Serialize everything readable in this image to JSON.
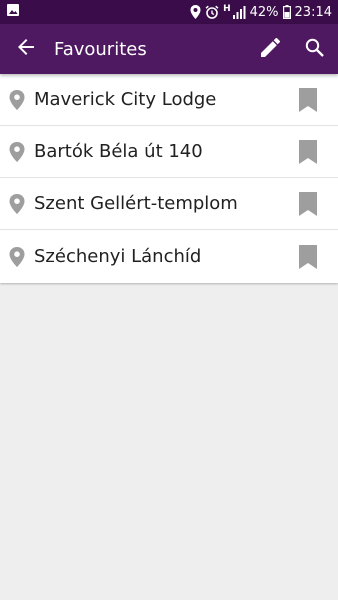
{
  "status_bar": {
    "battery": "42%",
    "time": "23:14",
    "network_h": "H"
  },
  "app_bar": {
    "title": "Favourites"
  },
  "favourites": [
    {
      "name": "Maverick City Lodge"
    },
    {
      "name": "Bartók Béla út 140"
    },
    {
      "name": "Szent Gellért-templom"
    },
    {
      "name": "Széchenyi Lánchíd"
    }
  ],
  "icons": {
    "back": "arrow-left-icon",
    "edit": "pencil-icon",
    "search": "search-icon",
    "pin": "location-pin-icon",
    "bookmark": "bookmark-icon"
  },
  "colors": {
    "status_bar": "#3a0d4a",
    "app_bar": "#4f1961",
    "icon_grey": "#9e9e9e",
    "background": "#eeeeee"
  }
}
